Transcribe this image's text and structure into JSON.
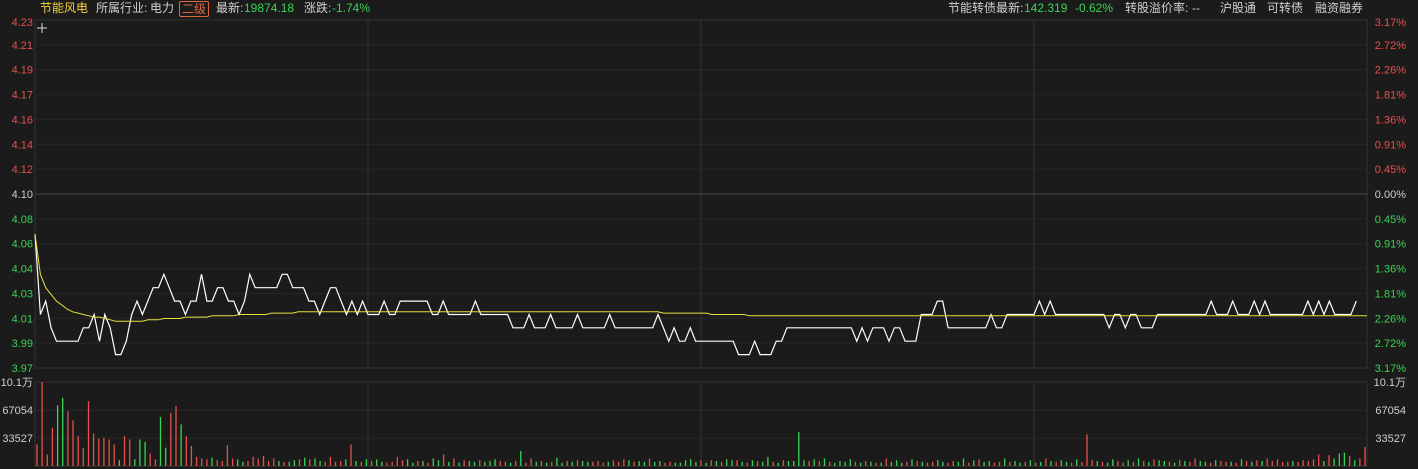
{
  "header": {
    "stock_name": "节能风电",
    "industry_label": "所属行业:",
    "industry_value": "电力",
    "level_badge": "二级",
    "latest_label": "最新:",
    "latest_value": "19874.18",
    "change_label": "涨跌:",
    "change_value": "-1.74%",
    "bond_label": "节能转债最新:",
    "bond_value": "142.319",
    "bond_change": "-0.62%",
    "premium_label": "转股溢价率:",
    "premium_value": "--",
    "link_hgt": "沪股通",
    "link_bond": "可转债",
    "link_margin": "融资融券"
  },
  "colors": {
    "background": "#1b1b1b",
    "price_line": "#ffffff",
    "avg_line": "#e8e23a",
    "up": "#e8504a",
    "down": "#39d353",
    "grid": "#333333",
    "zero_line": "#4a4a4a"
  },
  "chart_data": [
    {
      "type": "line",
      "name": "intraday-price",
      "y_labels_left": [
        "4.23",
        "4.21",
        "4.19",
        "4.17",
        "4.16",
        "4.14",
        "4.12",
        "4.10",
        "4.08",
        "4.06",
        "4.04",
        "4.03",
        "4.01",
        "3.99",
        "3.97"
      ],
      "y_labels_right": [
        "3.17%",
        "2.72%",
        "2.26%",
        "1.81%",
        "1.36%",
        "0.91%",
        "0.45%",
        "0.00%",
        "0.45%",
        "0.91%",
        "1.36%",
        "1.81%",
        "2.26%",
        "2.72%",
        "3.17%"
      ],
      "reference_price": 4.1,
      "ylim": [
        3.97,
        4.23
      ],
      "grid": true,
      "series": [
        {
          "values": [
            4.07,
            4.01,
            4.02,
            4.0,
            3.99,
            3.99,
            3.99,
            3.99,
            3.99,
            4.0,
            4.0,
            4.01,
            3.99,
            4.01,
            4.0,
            3.98,
            3.98,
            3.99,
            4.01,
            4.02,
            4.01,
            4.02,
            4.03,
            4.03,
            4.04,
            4.03,
            4.02,
            4.02,
            4.01,
            4.02,
            4.02,
            4.04,
            4.02,
            4.02,
            4.03,
            4.03,
            4.02,
            4.02,
            4.01,
            4.02,
            4.04,
            4.03,
            4.03,
            4.03,
            4.03,
            4.03,
            4.04,
            4.04,
            4.03,
            4.03,
            4.03,
            4.02,
            4.02,
            4.01,
            4.02,
            4.03,
            4.03,
            4.02,
            4.01,
            4.02,
            4.01,
            4.02,
            4.01,
            4.01,
            4.01,
            4.02,
            4.01,
            4.01,
            4.02,
            4.02,
            4.02,
            4.02,
            4.02,
            4.02,
            4.01,
            4.01,
            4.02,
            4.01,
            4.01,
            4.01,
            4.01,
            4.01,
            4.02,
            4.01,
            4.01,
            4.01,
            4.01,
            4.01,
            4.01,
            4.0,
            4.0,
            4.0,
            4.01,
            4.0,
            4.0,
            4.0,
            4.01,
            4.0,
            4.0,
            4.0,
            4.0,
            4.01,
            4.0,
            4.0,
            4.0,
            4.0,
            4.0,
            4.01,
            4.0,
            4.0,
            4.0,
            4.0,
            4.0,
            4.0,
            4.0,
            4.0,
            4.01,
            4.0,
            3.99,
            4.0,
            3.99,
            3.99,
            4.0,
            3.99,
            3.99,
            3.99,
            3.99,
            3.99,
            3.99,
            3.99,
            3.99,
            3.98,
            3.98,
            3.98,
            3.99,
            3.98,
            3.98,
            3.98,
            3.99,
            3.99,
            4.0,
            4.0,
            4.0,
            4.0,
            4.0,
            4.0,
            4.0,
            4.0,
            4.0,
            4.0,
            4.0,
            4.0,
            4.0,
            3.99,
            4.0,
            3.99,
            4.0,
            4.0,
            4.0,
            3.99,
            4.0,
            4.0,
            3.99,
            3.99,
            3.99,
            4.01,
            4.01,
            4.01,
            4.02,
            4.02,
            4.0,
            4.0,
            4.0,
            4.0,
            4.0,
            4.0,
            4.0,
            4.0,
            4.01,
            4.0,
            4.0,
            4.01,
            4.01,
            4.01,
            4.01,
            4.01,
            4.01,
            4.02,
            4.01,
            4.02,
            4.01,
            4.01,
            4.01,
            4.01,
            4.01,
            4.01,
            4.01,
            4.01,
            4.01,
            4.01,
            4.0,
            4.01,
            4.01,
            4.0,
            4.01,
            4.01,
            4.0,
            4.0,
            4.0,
            4.01,
            4.01,
            4.01,
            4.01,
            4.01,
            4.01,
            4.01,
            4.01,
            4.01,
            4.01,
            4.02,
            4.01,
            4.01,
            4.01,
            4.02,
            4.01,
            4.01,
            4.01,
            4.02,
            4.01,
            4.02,
            4.01,
            4.01,
            4.01,
            4.01,
            4.01,
            4.01,
            4.01,
            4.02,
            4.01,
            4.02,
            4.01,
            4.02,
            4.01,
            4.01,
            4.01,
            4.01,
            4.02
          ]
        },
        {
          "values": [
            4.07,
            4.04,
            4.03,
            4.025,
            4.02,
            4.017,
            4.014,
            4.012,
            4.011,
            4.01,
            4.009,
            4.008,
            4.008,
            4.007,
            4.006,
            4.005,
            4.005,
            4.005,
            4.005,
            4.005,
            4.005,
            4.006,
            4.006,
            4.006,
            4.007,
            4.007,
            4.007,
            4.007,
            4.008,
            4.008,
            4.008,
            4.008,
            4.008,
            4.009,
            4.009,
            4.009,
            4.009,
            4.009,
            4.01,
            4.01,
            4.01,
            4.01,
            4.01,
            4.01,
            4.011,
            4.011,
            4.011,
            4.011,
            4.011,
            4.012,
            4.012,
            4.012,
            4.012,
            4.012,
            4.012,
            4.012,
            4.012,
            4.012,
            4.012,
            4.012,
            4.012,
            4.012,
            4.012,
            4.012,
            4.012,
            4.012,
            4.012,
            4.012,
            4.012,
            4.012,
            4.012,
            4.012,
            4.012,
            4.012,
            4.012,
            4.012,
            4.012,
            4.012,
            4.012,
            4.012,
            4.012,
            4.012,
            4.012,
            4.012,
            4.012,
            4.012,
            4.012,
            4.012,
            4.012,
            4.012,
            4.012,
            4.012,
            4.012,
            4.012,
            4.012,
            4.012,
            4.012,
            4.012,
            4.012,
            4.012,
            4.012,
            4.012,
            4.012,
            4.012,
            4.012,
            4.012,
            4.012,
            4.012,
            4.012,
            4.012,
            4.012,
            4.012,
            4.012,
            4.012,
            4.012,
            4.012,
            4.012,
            4.011,
            4.011,
            4.011,
            4.011,
            4.011,
            4.011,
            4.011,
            4.011,
            4.011,
            4.01,
            4.01,
            4.01,
            4.01,
            4.01,
            4.01,
            4.01,
            4.009,
            4.009,
            4.009,
            4.009,
            4.009,
            4.009,
            4.009,
            4.009,
            4.009,
            4.009,
            4.009,
            4.009,
            4.009,
            4.009,
            4.009,
            4.009,
            4.009,
            4.009,
            4.009,
            4.009,
            4.009,
            4.009,
            4.009,
            4.009,
            4.009,
            4.009,
            4.009,
            4.009,
            4.009,
            4.009,
            4.009,
            4.009,
            4.009,
            4.009,
            4.009,
            4.009,
            4.009,
            4.009,
            4.009,
            4.009,
            4.009,
            4.009,
            4.009,
            4.009,
            4.009,
            4.009,
            4.009,
            4.009,
            4.009,
            4.009,
            4.009,
            4.009,
            4.009,
            4.009,
            4.009,
            4.009,
            4.009,
            4.009,
            4.009,
            4.009,
            4.009,
            4.009,
            4.009,
            4.009,
            4.009,
            4.009,
            4.009,
            4.009,
            4.009,
            4.009,
            4.009,
            4.009,
            4.009,
            4.009,
            4.009,
            4.009,
            4.009,
            4.009,
            4.009,
            4.009,
            4.009,
            4.009,
            4.009,
            4.009,
            4.009,
            4.009,
            4.009,
            4.009,
            4.009,
            4.009,
            4.009,
            4.009,
            4.009,
            4.009,
            4.009,
            4.009,
            4.009,
            4.009,
            4.009,
            4.009,
            4.009,
            4.009,
            4.009,
            4.009,
            4.009,
            4.009,
            4.009,
            4.009,
            4.009,
            4.009,
            4.009,
            4.009,
            4.009,
            4.009,
            4.009,
            4.009
          ]
        }
      ]
    },
    {
      "type": "bar",
      "name": "intraday-volume",
      "y_labels_left": [
        "10.1万",
        "67054",
        "33527"
      ],
      "y_labels_right": [
        "10.1万",
        "67054",
        "33527"
      ],
      "ylim": [
        0,
        101000
      ],
      "values": [
        26000,
        101000,
        14000,
        46000,
        73000,
        82000,
        66000,
        55000,
        36000,
        22000,
        78000,
        39000,
        33000,
        34000,
        32000,
        26000,
        7000,
        36000,
        32000,
        8000,
        32000,
        29000,
        15000,
        8000,
        59000,
        22000,
        64000,
        72000,
        50000,
        36000,
        24000,
        11000,
        9000,
        8000,
        10000,
        7000,
        6000,
        25000,
        9000,
        8000,
        5000,
        6000,
        11000,
        9000,
        12000,
        6000,
        9000,
        6000,
        5000,
        5000,
        7000,
        8000,
        10000,
        8000,
        9000,
        6000,
        5000,
        11000,
        5000,
        6000,
        8000,
        26000,
        6000,
        5000,
        8000,
        6000,
        8000,
        5000,
        4000,
        5000,
        11000,
        7000,
        8000,
        4000,
        6000,
        6000,
        4000,
        9000,
        7000,
        14000,
        5000,
        9000,
        4000,
        7000,
        6000,
        5000,
        7000,
        5000,
        6000,
        8000,
        6000,
        5000,
        4000,
        6000,
        18000,
        4000,
        9000,
        5000,
        6000,
        4000,
        5000,
        10000,
        4000,
        6000,
        5000,
        7000,
        6000,
        5000,
        5000,
        6000,
        4000,
        5000,
        7000,
        5000,
        8000,
        7000,
        5000,
        6000,
        5000,
        9000,
        5000,
        6000,
        4000,
        5000,
        4000,
        4000,
        7000,
        8000,
        5000,
        7000,
        4000,
        7000,
        6000,
        5000,
        8000,
        7000,
        7000,
        5000,
        4000,
        7000,
        6000,
        5000,
        11000,
        5000,
        4000,
        7000,
        6000,
        6000,
        41000,
        7000,
        6000,
        8000,
        6000,
        9000,
        5000,
        4000,
        6000,
        5000,
        8000,
        5000,
        4000,
        6000,
        5000,
        4000,
        4000,
        9000,
        5000,
        7000,
        4000,
        5000,
        8000,
        6000,
        5000,
        4000,
        5000,
        7000,
        5000,
        4000,
        6000,
        5000,
        9000,
        4000,
        7000,
        8000,
        5000,
        6000,
        4000,
        5000,
        9000,
        5000,
        6000,
        4000,
        5000,
        7000,
        4000,
        5000,
        9000,
        6000,
        5000,
        7000,
        5000,
        4000,
        8000,
        5000,
        38000,
        7000,
        6000,
        5000,
        4000,
        8000,
        6000,
        4000,
        7000,
        5000,
        9000,
        6000,
        5000,
        8000,
        7000,
        6000,
        5000,
        4000,
        7000,
        6000,
        5000,
        9000,
        6000,
        5000,
        4000,
        7000,
        6000,
        5000,
        5000,
        4000,
        8000,
        6000,
        5000,
        7000,
        6000,
        9000,
        6000,
        8000,
        5000,
        5000,
        6000,
        5000,
        7000,
        6000,
        8000,
        14000,
        6000,
        13000,
        9000,
        15000,
        16000,
        12000,
        7000,
        9000,
        23000
      ],
      "colors": [
        "up",
        "up",
        "up",
        "up",
        "down",
        "down",
        "up",
        "up",
        "up",
        "up",
        "up",
        "up",
        "up",
        "up",
        "up",
        "up",
        "down",
        "up",
        "up",
        "down",
        "down",
        "down",
        "up",
        "up",
        "down",
        "down",
        "up",
        "up",
        "down",
        "up",
        "up",
        "up",
        "up",
        "up",
        "down",
        "up",
        "up",
        "up",
        "up",
        "down",
        "down",
        "up",
        "up",
        "up",
        "up",
        "up",
        "up",
        "down",
        "up",
        "down",
        "down",
        "up",
        "down",
        "up",
        "down",
        "down",
        "up",
        "up",
        "up",
        "up",
        "down",
        "up",
        "down",
        "up",
        "down",
        "up",
        "down",
        "down",
        "up",
        "up",
        "up",
        "up",
        "down",
        "down",
        "up",
        "down",
        "up",
        "down",
        "down",
        "up",
        "down",
        "up",
        "down",
        "up",
        "down",
        "down",
        "up",
        "down",
        "down",
        "down",
        "up",
        "up",
        "down",
        "up",
        "down",
        "up",
        "up",
        "down",
        "up",
        "down",
        "up",
        "down",
        "down",
        "up",
        "down",
        "up",
        "down",
        "down",
        "up",
        "up",
        "up",
        "down",
        "up",
        "up",
        "up",
        "down",
        "up",
        "down",
        "down",
        "up",
        "down",
        "down",
        "up",
        "up",
        "down",
        "down",
        "down",
        "down",
        "down",
        "up",
        "down",
        "up",
        "down",
        "up",
        "down",
        "down",
        "up",
        "down",
        "up",
        "down",
        "up",
        "down",
        "down",
        "up",
        "down",
        "up",
        "down",
        "down",
        "down",
        "down",
        "up",
        "down",
        "up",
        "down",
        "up",
        "down",
        "down",
        "down",
        "down",
        "up",
        "down",
        "up",
        "down",
        "up",
        "down",
        "up",
        "down",
        "down",
        "down",
        "up",
        "down",
        "up",
        "down",
        "up",
        "up",
        "down",
        "down",
        "up",
        "up",
        "down",
        "down",
        "up",
        "down",
        "up",
        "down",
        "down",
        "up",
        "up",
        "down",
        "up",
        "down",
        "down",
        "up",
        "down",
        "up",
        "down",
        "up",
        "down",
        "up",
        "down",
        "down",
        "up",
        "down",
        "up",
        "up",
        "up",
        "down",
        "up",
        "down",
        "down",
        "up",
        "up",
        "down",
        "up",
        "down",
        "up",
        "down",
        "up",
        "down",
        "down",
        "up",
        "down",
        "up",
        "down",
        "up",
        "up",
        "down",
        "down",
        "up",
        "down",
        "up",
        "up",
        "down",
        "up",
        "down",
        "up",
        "down",
        "up",
        "down",
        "up",
        "up",
        "up",
        "up",
        "up",
        "down",
        "up",
        "up",
        "up",
        "up",
        "up",
        "down",
        "up",
        "down",
        "down",
        "down",
        "up",
        "down",
        "up",
        "up"
      ]
    }
  ]
}
